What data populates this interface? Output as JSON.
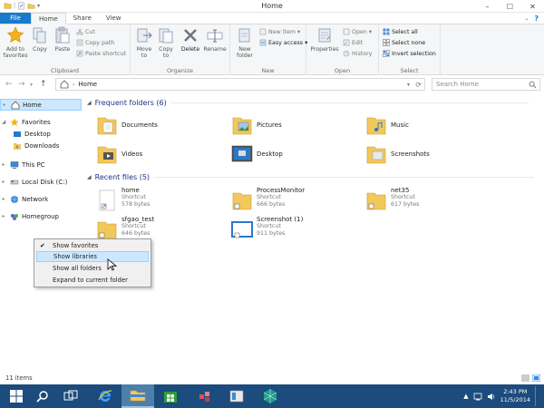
{
  "window": {
    "title": "Home"
  },
  "tabs": [
    "File",
    "Home",
    "Share",
    "View"
  ],
  "ribbon": {
    "clipboard": {
      "name": "Clipboard",
      "add_to_favorites": "Add to favorites",
      "copy": "Copy",
      "paste": "Paste",
      "cut": "Cut",
      "copy_path": "Copy path",
      "paste_shortcut": "Paste shortcut"
    },
    "organize": {
      "name": "Organize",
      "move_to": "Move to",
      "copy_to": "Copy to",
      "delete": "Delete",
      "rename": "Rename"
    },
    "new": {
      "name": "New",
      "new_folder": "New folder",
      "new_item": "New item",
      "easy_access": "Easy access"
    },
    "open": {
      "name": "Open",
      "properties": "Properties",
      "open": "Open",
      "edit": "Edit",
      "history": "History"
    },
    "select": {
      "name": "Select",
      "select_all": "Select all",
      "select_none": "Select none",
      "invert_selection": "Invert selection"
    }
  },
  "address": {
    "path": "Home",
    "search_placeholder": "Search Home"
  },
  "nav": {
    "home": "Home",
    "favorites": "Favorites",
    "desktop": "Desktop",
    "downloads": "Downloads",
    "this_pc": "This PC",
    "local_disk": "Local Disk (C:)",
    "network": "Network",
    "homegroup": "Homegroup"
  },
  "frequent": {
    "header": "Frequent folders (6)",
    "items": [
      "Documents",
      "Pictures",
      "Music",
      "Videos",
      "Desktop",
      "Screenshots"
    ]
  },
  "recent": {
    "header": "Recent files (5)",
    "items": [
      {
        "name": "home",
        "type": "Shortcut",
        "size": "578 bytes"
      },
      {
        "name": "ProcessMonitor",
        "type": "Shortcut",
        "size": "666 bytes"
      },
      {
        "name": "net35",
        "type": "Shortcut",
        "size": "617 bytes"
      },
      {
        "name": "sfgao_test",
        "type": "Shortcut",
        "size": "646 bytes"
      },
      {
        "name": "Screenshot (1)",
        "type": "Shortcut",
        "size": "911 bytes"
      }
    ]
  },
  "context_menu": {
    "items": [
      "Show favorites",
      "Show libraries",
      "Show all folders",
      "Expand to current folder"
    ],
    "checked": "Show favorites",
    "highlighted": "Show libraries"
  },
  "status": {
    "items": "11 items"
  },
  "taskbar": {
    "time": "2:43 PM",
    "date": "11/5/2014"
  },
  "colors": {
    "accent": "#1979ca",
    "selection": "#cce8ff",
    "folder": "#f2c85b",
    "taskbar": "#1c4b7d"
  }
}
